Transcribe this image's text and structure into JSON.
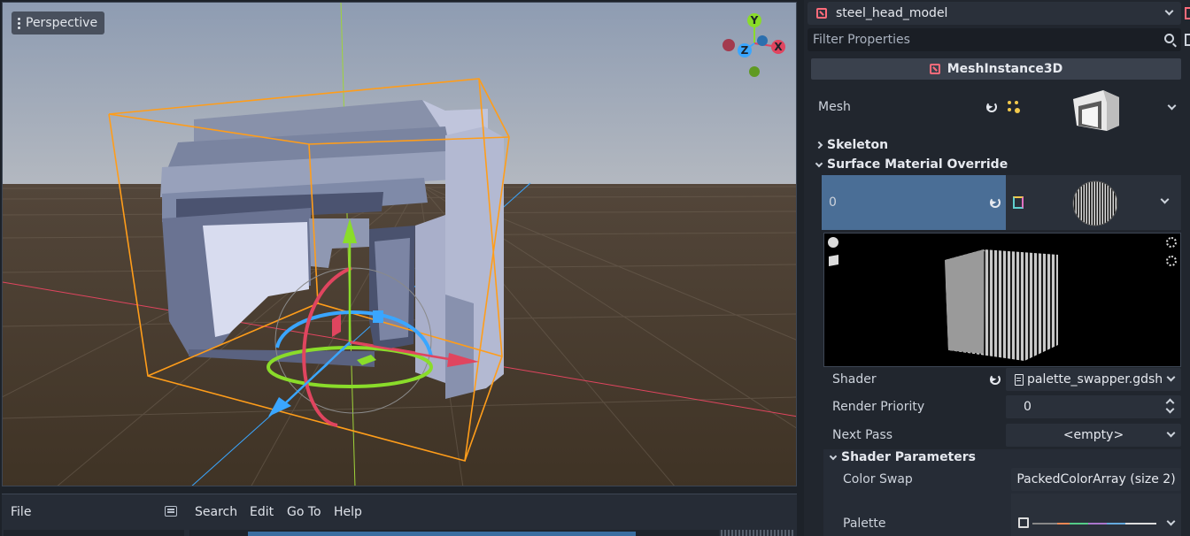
{
  "viewport": {
    "perspective_label": "Perspective",
    "gizmo": {
      "x": "X",
      "y": "Y",
      "z": "Z"
    }
  },
  "script_menu": {
    "file": "File",
    "search": "Search",
    "edit": "Edit",
    "goto": "Go To",
    "help": "Help"
  },
  "inspector": {
    "resource_name": "steel_head_model",
    "filter_placeholder": "Filter Properties",
    "class_name": "MeshInstance3D",
    "mesh_label": "Mesh",
    "skeleton_label": "Skeleton",
    "surface_override_label": "Surface Material Override",
    "slot_index": "0",
    "shader_label": "Shader",
    "shader_value": "palette_swapper.gdsh",
    "render_priority_label": "Render Priority",
    "render_priority_value": "0",
    "next_pass_label": "Next Pass",
    "next_pass_value": "<empty>",
    "shader_params_label": "Shader Parameters",
    "color_swap_label": "Color Swap",
    "color_swap_value": "PackedColorArray (size 2)",
    "palette_label": "Palette"
  },
  "colors": {
    "accent": "#4a6e96",
    "node_icon": "#ff6b7a",
    "selection": "#ff9d1a",
    "axis_x": "#ff3b5f",
    "axis_y": "#8adc2a",
    "axis_z": "#3aa6ff"
  }
}
